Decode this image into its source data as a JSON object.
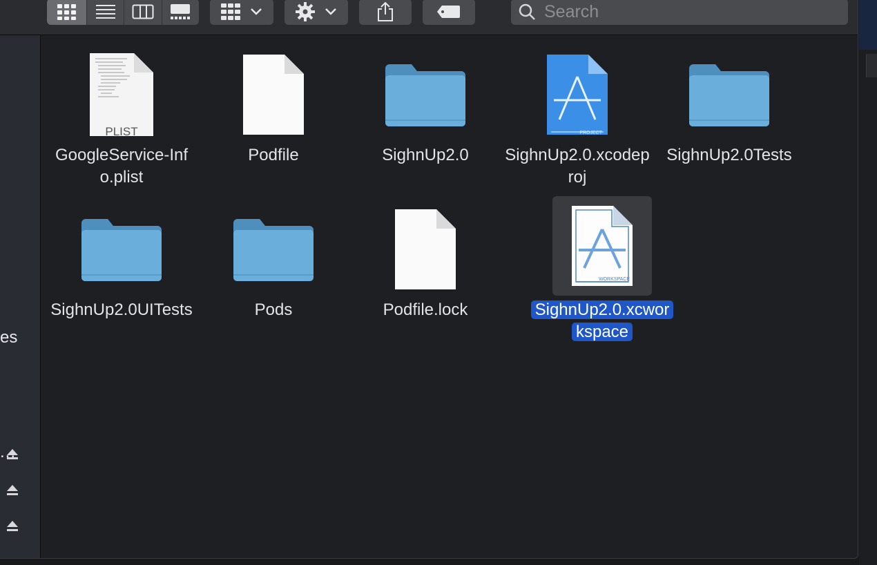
{
  "toolbar": {
    "search_placeholder": "Search"
  },
  "sidebar": {
    "partial_label": "es",
    "ellipsis": "..."
  },
  "files": [
    {
      "name": "GoogleService-Info.plist",
      "kind": "plist",
      "badge": "PLIST"
    },
    {
      "name": "Podfile",
      "kind": "document"
    },
    {
      "name": "SighnUp2.0",
      "kind": "folder"
    },
    {
      "name": "SighnUp2.0.xcodeproj",
      "kind": "xcodeproj",
      "badge": "PROJECT"
    },
    {
      "name": "SighnUp2.0Tests",
      "kind": "folder"
    },
    {
      "name": "SighnUp2.0UITests",
      "kind": "folder"
    },
    {
      "name": "Pods",
      "kind": "folder"
    },
    {
      "name": "Podfile.lock",
      "kind": "document"
    },
    {
      "name": "SighnUp2.0.xcworkspace",
      "kind": "xcworkspace",
      "badge": "WORKSPACE",
      "selected": true
    }
  ],
  "colors": {
    "selection": "#1f57c8",
    "folder": "#6aaedb",
    "xcode_blue": "#3b8fe6"
  }
}
